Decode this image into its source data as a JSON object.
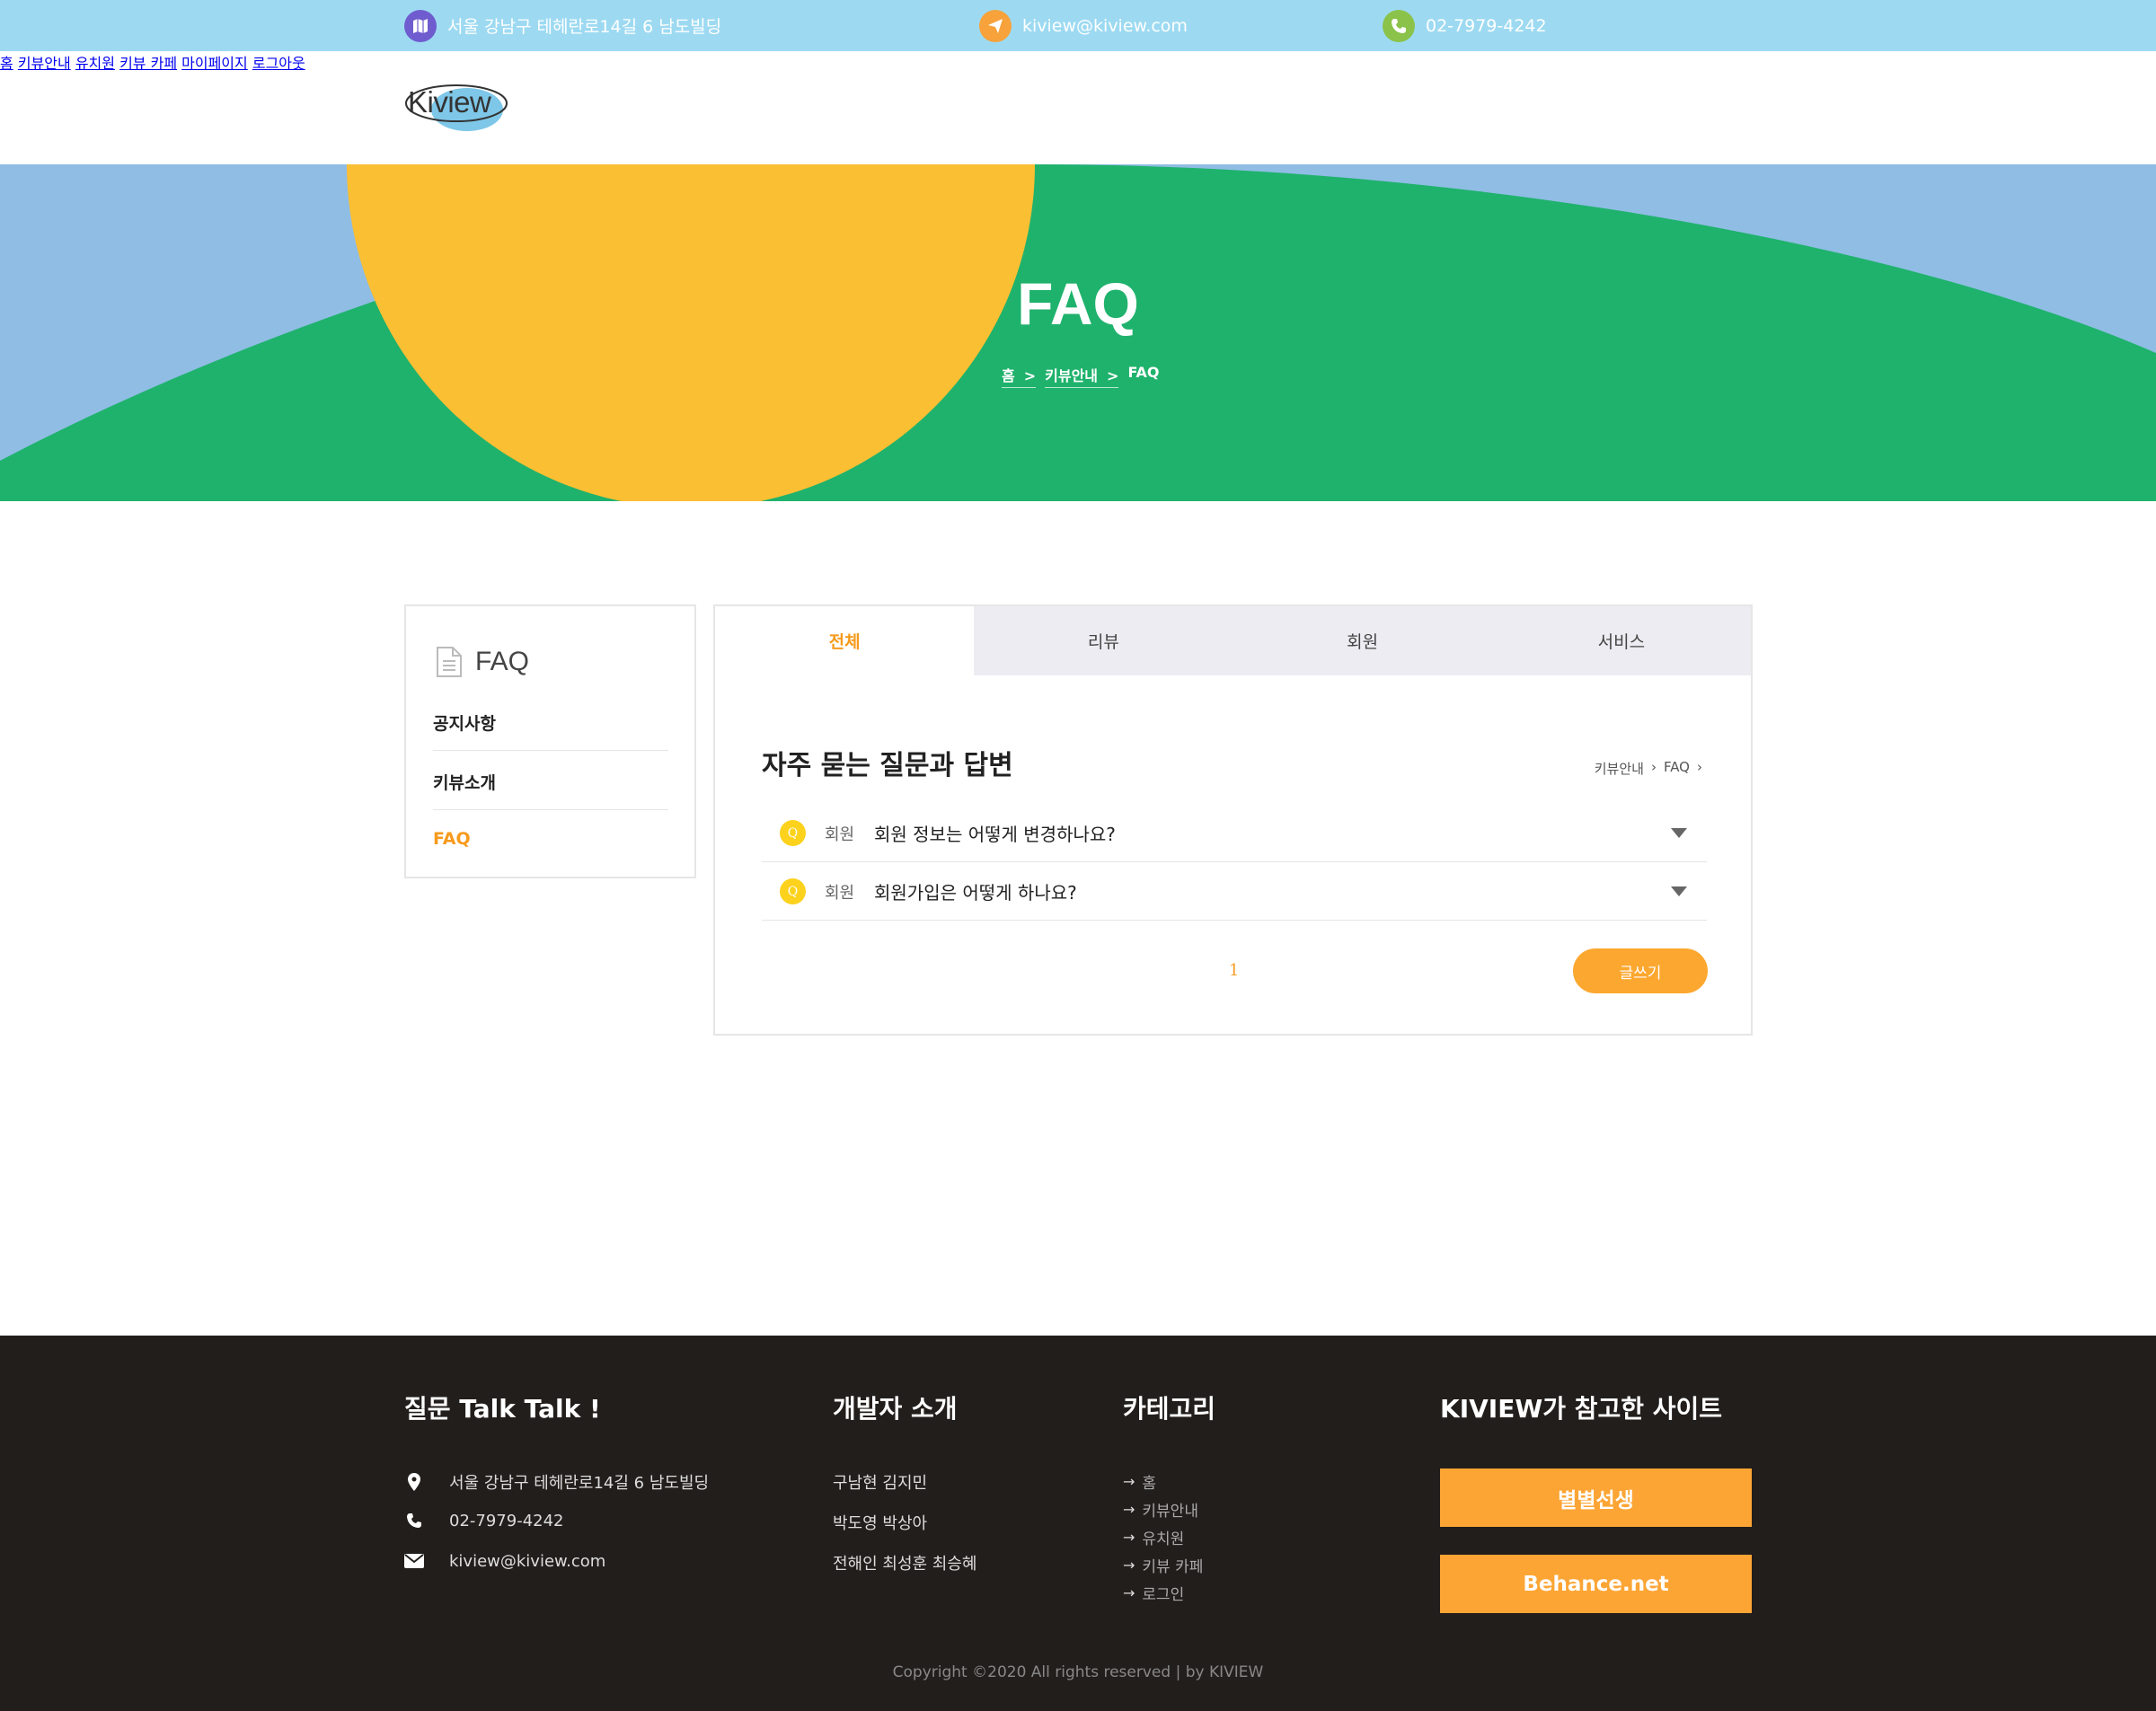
{
  "topbar": {
    "address": "서울 강남구 테헤란로14길 6 남도빌딩",
    "email": "kiview@kiview.com",
    "phone": "02-7979-4242",
    "icon_colors": {
      "map": "#6f5ccf",
      "mail": "#f7a23a",
      "phone": "#8bc34a"
    }
  },
  "header": {
    "logo_text": "Kiview",
    "nav": [
      "홈",
      "키뷰안내",
      "유치원",
      "키뷰 카페",
      "마이페이지",
      "로그아웃"
    ]
  },
  "hero": {
    "title": "FAQ",
    "breadcrumb": [
      "홈",
      "키뷰안내",
      "FAQ"
    ],
    "colors": {
      "sky": "#8fbde4",
      "hill": "#1fb26c",
      "sun": "#fbbf33"
    }
  },
  "sidebar": {
    "title": "FAQ",
    "items": [
      {
        "label": "공지사항",
        "active": false
      },
      {
        "label": "키뷰소개",
        "active": false
      },
      {
        "label": "FAQ",
        "active": true
      }
    ]
  },
  "content": {
    "tabs": [
      "전체",
      "리뷰",
      "회원",
      "서비스"
    ],
    "active_tab": "전체",
    "title": "자주 묻는 질문과 답변",
    "breadcrumb": [
      "키뷰안내",
      "FAQ"
    ],
    "questions": [
      {
        "badge": "Q",
        "category": "회원",
        "text": "회원 정보는 어떻게 변경하나요?"
      },
      {
        "badge": "Q",
        "category": "회원",
        "text": "회원가입은 어떻게 하나요?"
      }
    ],
    "page": "1",
    "write_button": "글쓰기",
    "accent": "#f79a1d"
  },
  "footer": {
    "contact_title": "질문 Talk Talk !",
    "contact": {
      "address": "서울 강남구 테헤란로14길 6 남도빌딩",
      "phone": "02-7979-4242",
      "email": "kiview@kiview.com"
    },
    "dev_title": "개발자 소개",
    "developers": [
      "구남현 김지민",
      "박도영 박상아",
      "전해인 최성훈 최승혜"
    ],
    "category_title": "카테고리",
    "categories": [
      "홈",
      "키뷰안내",
      "유치원",
      "키뷰 카페",
      "로그인"
    ],
    "ref_title": "KIVIEW가 참고한 사이트",
    "ref_sites": [
      "별별선생",
      "Behance.net"
    ],
    "copyright": "Copyright ©2020 All rights reserved | by KIVIEW"
  }
}
